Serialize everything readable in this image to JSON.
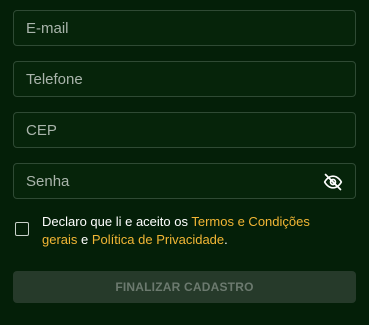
{
  "form": {
    "email": {
      "placeholder": "E-mail",
      "value": ""
    },
    "phone": {
      "placeholder": "Telefone",
      "value": ""
    },
    "cep": {
      "placeholder": "CEP",
      "value": ""
    },
    "password": {
      "placeholder": "Senha",
      "value": "",
      "toggle_icon": "eye-slash-icon"
    }
  },
  "terms": {
    "text_before": "Declaro que li e aceito os ",
    "terms_link": "Termos e Condições gerais",
    "text_middle": " e ",
    "privacy_link": "Política de Privacidade",
    "text_after": ".",
    "checked": false
  },
  "submit": {
    "label": "FINALIZAR CADASTRO",
    "disabled": true
  },
  "colors": {
    "background": "#041f08",
    "field_border": "#2f4a34",
    "link": "#f2b635",
    "button_disabled_bg": "#263a2a",
    "button_disabled_text": "#6c7a6f"
  }
}
